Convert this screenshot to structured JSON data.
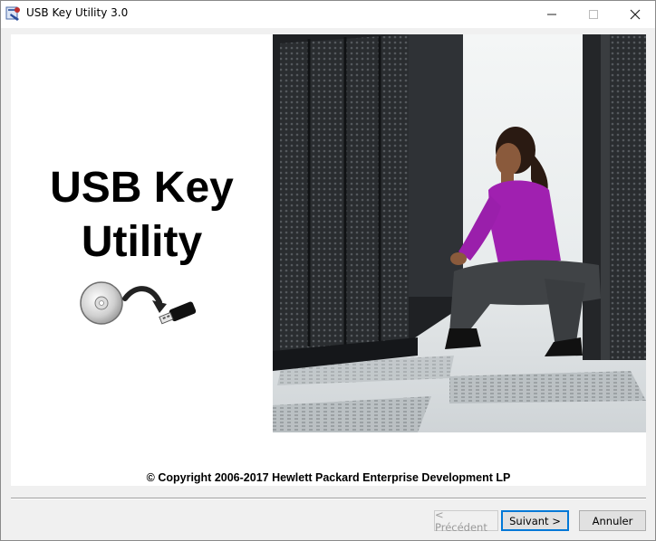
{
  "window": {
    "title": "USB Key Utility 3.0",
    "controls": {
      "minimize": "minimize-icon",
      "maximize": "maximize-icon",
      "close": "close-icon"
    }
  },
  "content": {
    "heading_line1": "USB Key",
    "heading_line2": "Utility",
    "copyright": "© Copyright 2006-2017 Hewlett Packard Enterprise Development LP",
    "illustration_icons": [
      "cd-disc-icon",
      "arrow-icon",
      "usb-drive-icon"
    ]
  },
  "buttons": {
    "previous": "< Précédent",
    "next": "Suivant >",
    "cancel": "Annuler"
  },
  "colors": {
    "accent": "#0078d7",
    "shirt": "#a020b0"
  }
}
